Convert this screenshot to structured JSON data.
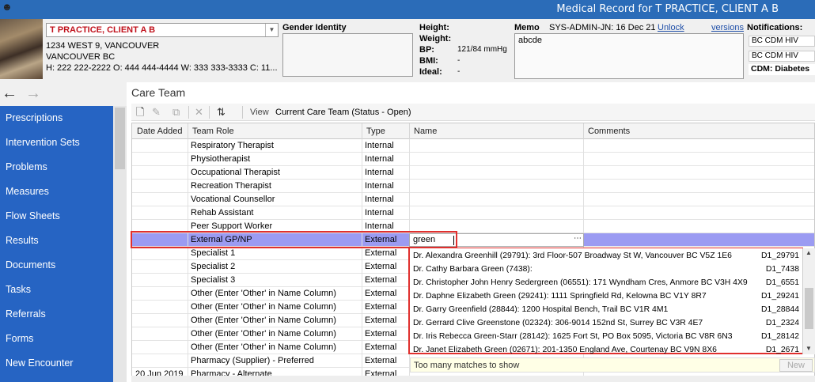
{
  "window": {
    "title": "Medical Record for T PRACTICE, CLIENT A B"
  },
  "patient": {
    "name": "T PRACTICE, CLIENT A B",
    "address1": "1234 WEST 9, VANCOUVER",
    "address2": "VANCOUVER BC",
    "phones": "H: 222 222-2222 O: 444 444-4444 W: 333 333-3333 C: 11..."
  },
  "gender": {
    "label": "Gender Identity"
  },
  "vitals": {
    "height_label": "Height:",
    "height_value": "",
    "weight_label": "Weight:",
    "weight_value": "",
    "bp_label": "BP:",
    "bp_value": "121/84 mmHg",
    "bmi_label": "BMI:",
    "bmi_value": "-",
    "ideal_label": "Ideal:",
    "ideal_value": "-"
  },
  "memo": {
    "label": "Memo",
    "author": "SYS-ADMIN-JN: 16 Dec 21",
    "unlock": "Unlock",
    "versions": "versions",
    "text": "abcde"
  },
  "notifications": {
    "label": "Notifications:",
    "items": [
      "BC CDM HIV",
      "BC CDM HIV"
    ],
    "cdm": "CDM: Diabetes"
  },
  "sidebar": {
    "items": [
      "Prescriptions",
      "Intervention Sets",
      "Problems",
      "Measures",
      "Flow Sheets",
      "Results",
      "Documents",
      "Tasks",
      "Referrals",
      "Forms",
      "New Encounter"
    ]
  },
  "section": {
    "title": "Care Team"
  },
  "toolbar": {
    "view_label": "View",
    "view_value": "Current Care Team (Status - Open)"
  },
  "grid": {
    "headers": {
      "date": "Date Added",
      "role": "Team Role",
      "type": "Type",
      "name": "Name",
      "comments": "Comments"
    },
    "rows_top": [
      {
        "date": "",
        "role": "Respiratory Therapist",
        "type": "Internal"
      },
      {
        "date": "",
        "role": "Physiotherapist",
        "type": "Internal"
      },
      {
        "date": "",
        "role": "Occupational Therapist",
        "type": "Internal"
      },
      {
        "date": "",
        "role": "Recreation Therapist",
        "type": "Internal"
      },
      {
        "date": "",
        "role": "Vocational Counsellor",
        "type": "Internal"
      },
      {
        "date": "",
        "role": "Rehab Assistant",
        "type": "Internal"
      },
      {
        "date": "",
        "role": "Peer Support Worker",
        "type": "Internal"
      }
    ],
    "selected": {
      "role": "External GP/NP",
      "type": "External",
      "name_value": "green"
    },
    "rows_bottom": [
      {
        "date": "",
        "role": "Specialist 1",
        "type": "External"
      },
      {
        "date": "",
        "role": "Specialist 2",
        "type": "External"
      },
      {
        "date": "",
        "role": "Specialist 3",
        "type": "External"
      },
      {
        "date": "",
        "role": "Other (Enter 'Other' in Name Column)",
        "type": "External"
      },
      {
        "date": "",
        "role": "Other (Enter 'Other' in Name Column)",
        "type": "External"
      },
      {
        "date": "",
        "role": "Other (Enter 'Other' in Name Column)",
        "type": "External"
      },
      {
        "date": "",
        "role": "Other (Enter 'Other' in Name Column)",
        "type": "External"
      },
      {
        "date": "",
        "role": "Other (Enter 'Other' in Name Column)",
        "type": "External"
      },
      {
        "date": "",
        "role": "Pharmacy (Supplier) - Preferred",
        "type": "External"
      },
      {
        "date": "20 Jun 2019",
        "role": "Pharmacy - Alternate",
        "type": "External"
      }
    ]
  },
  "lookup": {
    "matches": [
      {
        "text": "Dr. Alexandra Greenhill (29791): 3rd Floor-507 Broadway St W, Vancouver BC V5Z 1E6",
        "id": "D1_29791"
      },
      {
        "text": "Dr. Cathy Barbara Green (7438):",
        "id": "D1_7438"
      },
      {
        "text": "Dr. Christopher John Henry Sedergreen (06551): 171 Wyndham Cres, Anmore BC V3H 4X9",
        "id": "D1_6551"
      },
      {
        "text": "Dr. Daphne Elizabeth Green (29241): 1111 Springfield Rd, Kelowna BC V1Y 8R7",
        "id": "D1_29241"
      },
      {
        "text": "Dr. Garry Greenfield (28844): 1200 Hospital Bench, Trail BC V1R 4M1",
        "id": "D1_28844"
      },
      {
        "text": "Dr. Gerrard Clive Greenstone (02324): 306-9014 152nd St, Surrey BC V3R 4E7",
        "id": "D1_2324"
      },
      {
        "text": "Dr. Iris Rebecca Green-Starr (28142): 1625 Fort St, PO Box 5095, Victoria BC V8R 6N3",
        "id": "D1_28142"
      },
      {
        "text": "Dr. Janet Elizabeth Green (02671): 201-1350 England Ave, Courtenay BC V9N 8X6",
        "id": "D1_2671"
      }
    ],
    "status": "Too many matches to show",
    "new_button": "New"
  },
  "colors": {
    "sidebar": "#2664c3",
    "titlebar": "#2b6cb8",
    "selection": "#9b9bf2",
    "highlight": "#e0302e"
  }
}
